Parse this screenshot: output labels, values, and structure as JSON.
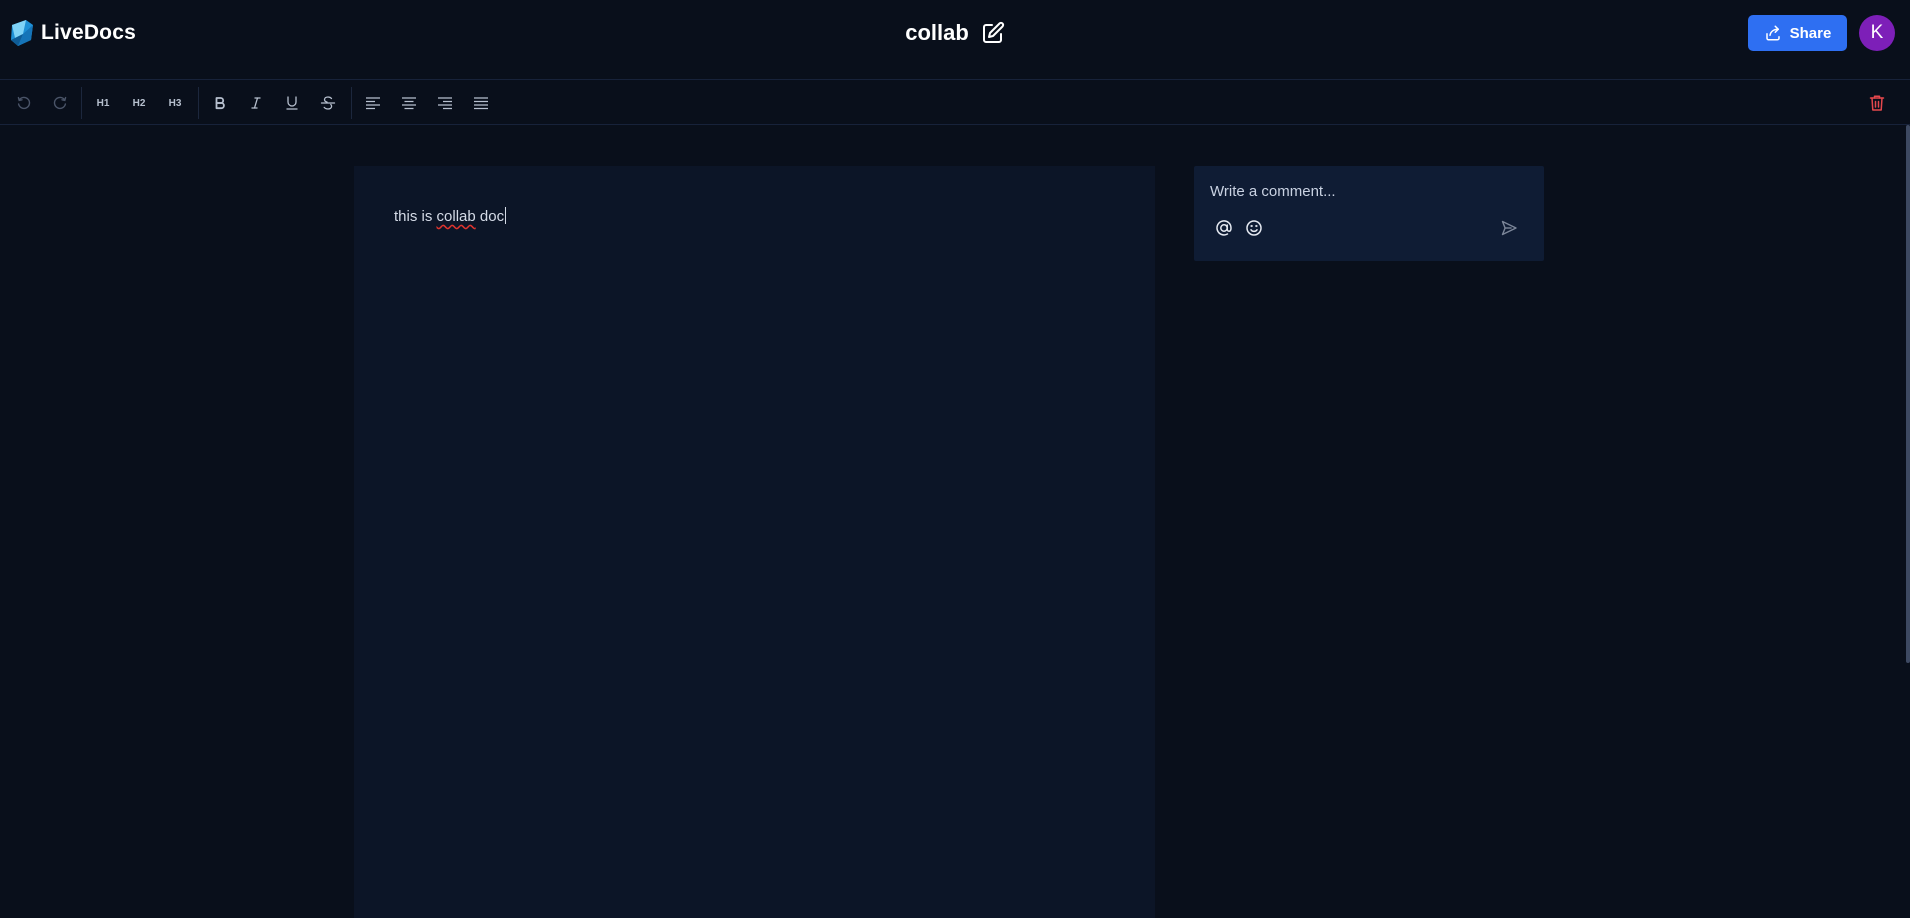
{
  "app": {
    "name": "LiveDocs",
    "logo_icon": "livedocs-logo-icon"
  },
  "document": {
    "title": "collab",
    "content": {
      "before_error": "this is ",
      "misspelled": "collab",
      "after_error": " doc"
    }
  },
  "header": {
    "edit_icon": "pencil-square-icon",
    "share": {
      "label": "Share",
      "icon": "share-icon"
    },
    "avatar": {
      "initial": "K",
      "color": "#7d1fb8"
    }
  },
  "toolbar": {
    "history": [
      {
        "name": "undo-button",
        "icon": "undo-icon"
      },
      {
        "name": "redo-button",
        "icon": "redo-icon"
      }
    ],
    "headings": [
      "H1",
      "H2",
      "H3"
    ],
    "formatting": [
      {
        "name": "bold-button",
        "icon": "bold-icon"
      },
      {
        "name": "italic-button",
        "icon": "italic-icon"
      },
      {
        "name": "underline-button",
        "icon": "underline-icon"
      },
      {
        "name": "strikethrough-button",
        "icon": "strikethrough-icon"
      }
    ],
    "alignment": [
      {
        "name": "align-left-button",
        "icon": "align-left-icon"
      },
      {
        "name": "align-center-button",
        "icon": "align-center-icon"
      },
      {
        "name": "align-right-button",
        "icon": "align-right-icon"
      },
      {
        "name": "align-justify-button",
        "icon": "align-justify-icon"
      }
    ],
    "delete_icon": "trash-icon"
  },
  "comment": {
    "value": "",
    "placeholder": "Write a comment...",
    "icons": [
      "at-sign-icon",
      "smiley-icon",
      "send-icon"
    ]
  },
  "colors": {
    "background": "#090f1b",
    "editor_page": "#0c1527",
    "comment_box": "#0f1c34",
    "accent": "#2e6ff2",
    "danger": "#e5484d"
  }
}
